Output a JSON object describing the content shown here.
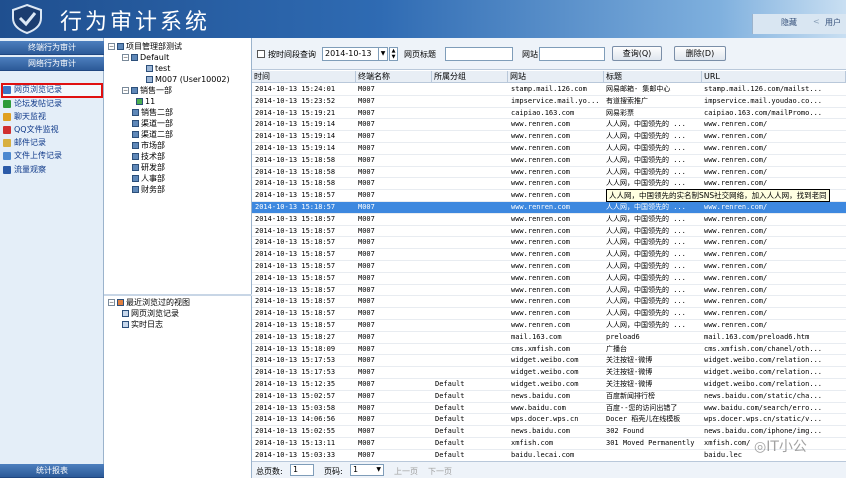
{
  "app": {
    "title": "行为审计系统"
  },
  "header": {
    "hide_label": "隐藏",
    "user_label": "用户"
  },
  "left_nav": {
    "section1": "终端行为审计",
    "section2": "网络行为审计",
    "items": [
      {
        "label": "网页浏览记录",
        "icon": "browser-icon",
        "color": "#3a74c6"
      },
      {
        "label": "论坛发帖记录",
        "icon": "forum-icon",
        "color": "#2e9b3a"
      },
      {
        "label": "聊天监视",
        "icon": "chat-icon",
        "color": "#e0a020"
      },
      {
        "label": "QQ文件监视",
        "icon": "qq-icon",
        "color": "#d03030"
      },
      {
        "label": "邮件记录",
        "icon": "mail-icon",
        "color": "#d8b040"
      },
      {
        "label": "文件上传记录",
        "icon": "upload-icon",
        "color": "#4a88d0"
      },
      {
        "label": "流量观察",
        "icon": "traffic-icon",
        "color": "#2a5aa8"
      }
    ],
    "footer": "统计报表"
  },
  "tree": {
    "root": "项目管理部测试",
    "nodes": [
      {
        "label": "Default"
      },
      {
        "label": "test"
      },
      {
        "label": "M007  (User10002)"
      },
      {
        "label": "销售一部"
      },
      {
        "label": "11"
      },
      {
        "label": "销售二部"
      },
      {
        "label": "渠道一部"
      },
      {
        "label": "渠道二部"
      },
      {
        "label": "市场部"
      },
      {
        "label": "技术部"
      },
      {
        "label": "研发部"
      },
      {
        "label": "人事部"
      },
      {
        "label": "财务部"
      }
    ],
    "bottom_root": "最近浏览过的视图",
    "bottom_items": [
      "网页浏览记录",
      "实时日志"
    ]
  },
  "toolbar": {
    "time_checkbox_label": "按时间段查询",
    "date_value": "2014-10-13",
    "title_label": "网页标题",
    "title_value": "",
    "site_label": "网站",
    "site_value": "",
    "query_button": "查询(Q)",
    "delete_button": "删除(D)"
  },
  "grid": {
    "columns": [
      "时间",
      "终端名称",
      "所属分组",
      "网站",
      "标题",
      "URL"
    ],
    "rows": [
      [
        "2014-10-13 15:24:01",
        "M007",
        "",
        "stamp.mail.126.com",
        "网易邮箱- 集邮中心",
        "stamp.mail.126.com/mailst..."
      ],
      [
        "2014-10-13 15:23:52",
        "M007",
        "",
        "impservice.mail.yo...",
        "有道搜索推广",
        "impservice.mail.youdao.co..."
      ],
      [
        "2014-10-13 15:19:21",
        "M007",
        "",
        "caipiao.163.com",
        "网易彩票",
        "caipiao.163.com/mailPromo..."
      ],
      [
        "2014-10-13 15:19:14",
        "M007",
        "",
        "www.renren.com",
        "人人网，中国领先的 ...",
        "www.renren.com/"
      ],
      [
        "2014-10-13 15:19:14",
        "M007",
        "",
        "www.renren.com",
        "人人网，中国领先的 ...",
        "www.renren.com/"
      ],
      [
        "2014-10-13 15:19:14",
        "M007",
        "",
        "www.renren.com",
        "人人网，中国领先的 ...",
        "www.renren.com/"
      ],
      [
        "2014-10-13 15:18:58",
        "M007",
        "",
        "www.renren.com",
        "人人网，中国领先的 ...",
        "www.renren.com/"
      ],
      [
        "2014-10-13 15:18:58",
        "M007",
        "",
        "www.renren.com",
        "人人网，中国领先的 ...",
        "www.renren.com/"
      ],
      [
        "2014-10-13 15:18:58",
        "M007",
        "",
        "www.renren.com",
        "人人网，中国领先的 ...",
        "www.renren.com/"
      ],
      [
        "2014-10-13 15:18:57",
        "M007",
        "",
        "www.renren.com",
        "人人网，中国领先的 ...",
        "www.renren.com/"
      ],
      [
        "2014-10-13 15:18:57",
        "M007",
        "",
        "www.renren.com",
        "人人网，中国领先的 ...",
        "www.renren.com/"
      ],
      [
        "2014-10-13 15:18:57",
        "M007",
        "",
        "www.renren.com",
        "人人网，中国领先的 ...",
        "www.renren.com/"
      ],
      [
        "2014-10-13 15:18:57",
        "M007",
        "",
        "www.renren.com",
        "人人网，中国领先的 ...",
        "www.renren.com/"
      ],
      [
        "2014-10-13 15:18:57",
        "M007",
        "",
        "www.renren.com",
        "人人网，中国领先的 ...",
        "www.renren.com/"
      ],
      [
        "2014-10-13 15:18:57",
        "M007",
        "",
        "www.renren.com",
        "人人网，中国领先的 ...",
        "www.renren.com/"
      ],
      [
        "2014-10-13 15:18:57",
        "M007",
        "",
        "www.renren.com",
        "人人网，中国领先的 ...",
        "www.renren.com/"
      ],
      [
        "2014-10-13 15:18:57",
        "M007",
        "",
        "www.renren.com",
        "人人网，中国领先的 ...",
        "www.renren.com/"
      ],
      [
        "2014-10-13 15:18:57",
        "M007",
        "",
        "www.renren.com",
        "人人网，中国领先的 ...",
        "www.renren.com/"
      ],
      [
        "2014-10-13 15:18:57",
        "M007",
        "",
        "www.renren.com",
        "人人网，中国领先的 ...",
        "www.renren.com/"
      ],
      [
        "2014-10-13 15:18:57",
        "M007",
        "",
        "www.renren.com",
        "人人网，中国领先的 ...",
        "www.renren.com/"
      ],
      [
        "2014-10-13 15:18:57",
        "M007",
        "",
        "www.renren.com",
        "人人网，中国领先的 ...",
        "www.renren.com/"
      ],
      [
        "2014-10-13 15:18:27",
        "M007",
        "",
        "mail.163.com",
        "preload6",
        "mail.163.com/preload6.htm"
      ],
      [
        "2014-10-13 15:18:09",
        "M007",
        "",
        "cms.xmfish.com",
        "广播台",
        "cms.xmfish.com/chanel/oth..."
      ],
      [
        "2014-10-13 15:17:53",
        "M007",
        "",
        "widget.weibo.com",
        "关注按钮-微博",
        "widget.weibo.com/relation..."
      ],
      [
        "2014-10-13 15:17:53",
        "M007",
        "",
        "widget.weibo.com",
        "关注按钮-微博",
        "widget.weibo.com/relation..."
      ],
      [
        "2014-10-13 15:12:35",
        "M007",
        "Default",
        "widget.weibo.com",
        "关注按钮-微博",
        "widget.weibo.com/relation..."
      ],
      [
        "2014-10-13 15:02:57",
        "M007",
        "Default",
        "news.baidu.com",
        "百度新闻排行榜",
        "news.baidu.com/static/cha..."
      ],
      [
        "2014-10-13 15:03:58",
        "M007",
        "Default",
        "www.baidu.com",
        "百度--您的访问出错了",
        "www.baidu.com/search/erro..."
      ],
      [
        "2014-10-13 14:06:56",
        "M007",
        "Default",
        "wps.docer.wps.cn",
        "Docer 稻壳儿在线模板",
        "wps.docer.wps.cn/static/v..."
      ],
      [
        "2014-10-13 15:02:55",
        "M007",
        "Default",
        "news.baidu.com",
        "302 Found",
        "news.baidu.com/iphone/img..."
      ],
      [
        "2014-10-13 15:13:11",
        "M007",
        "Default",
        "xmfish.com",
        "301 Moved Permanently",
        "xmfish.com/"
      ],
      [
        "2014-10-13 15:03:33",
        "M007",
        "Default",
        "baidu.lecai.com",
        "",
        "baidu.lec"
      ]
    ],
    "selected_index": 10,
    "tooltip": "人人网，中国领先的实名制SNS社交网络，加入人人网，找到老同"
  },
  "pager": {
    "total_label": "总页数:",
    "total_value": "1",
    "page_label": "页码:",
    "page_value": "1",
    "prev": "上一页",
    "next": "下一页"
  },
  "watermark": "IT小公"
}
